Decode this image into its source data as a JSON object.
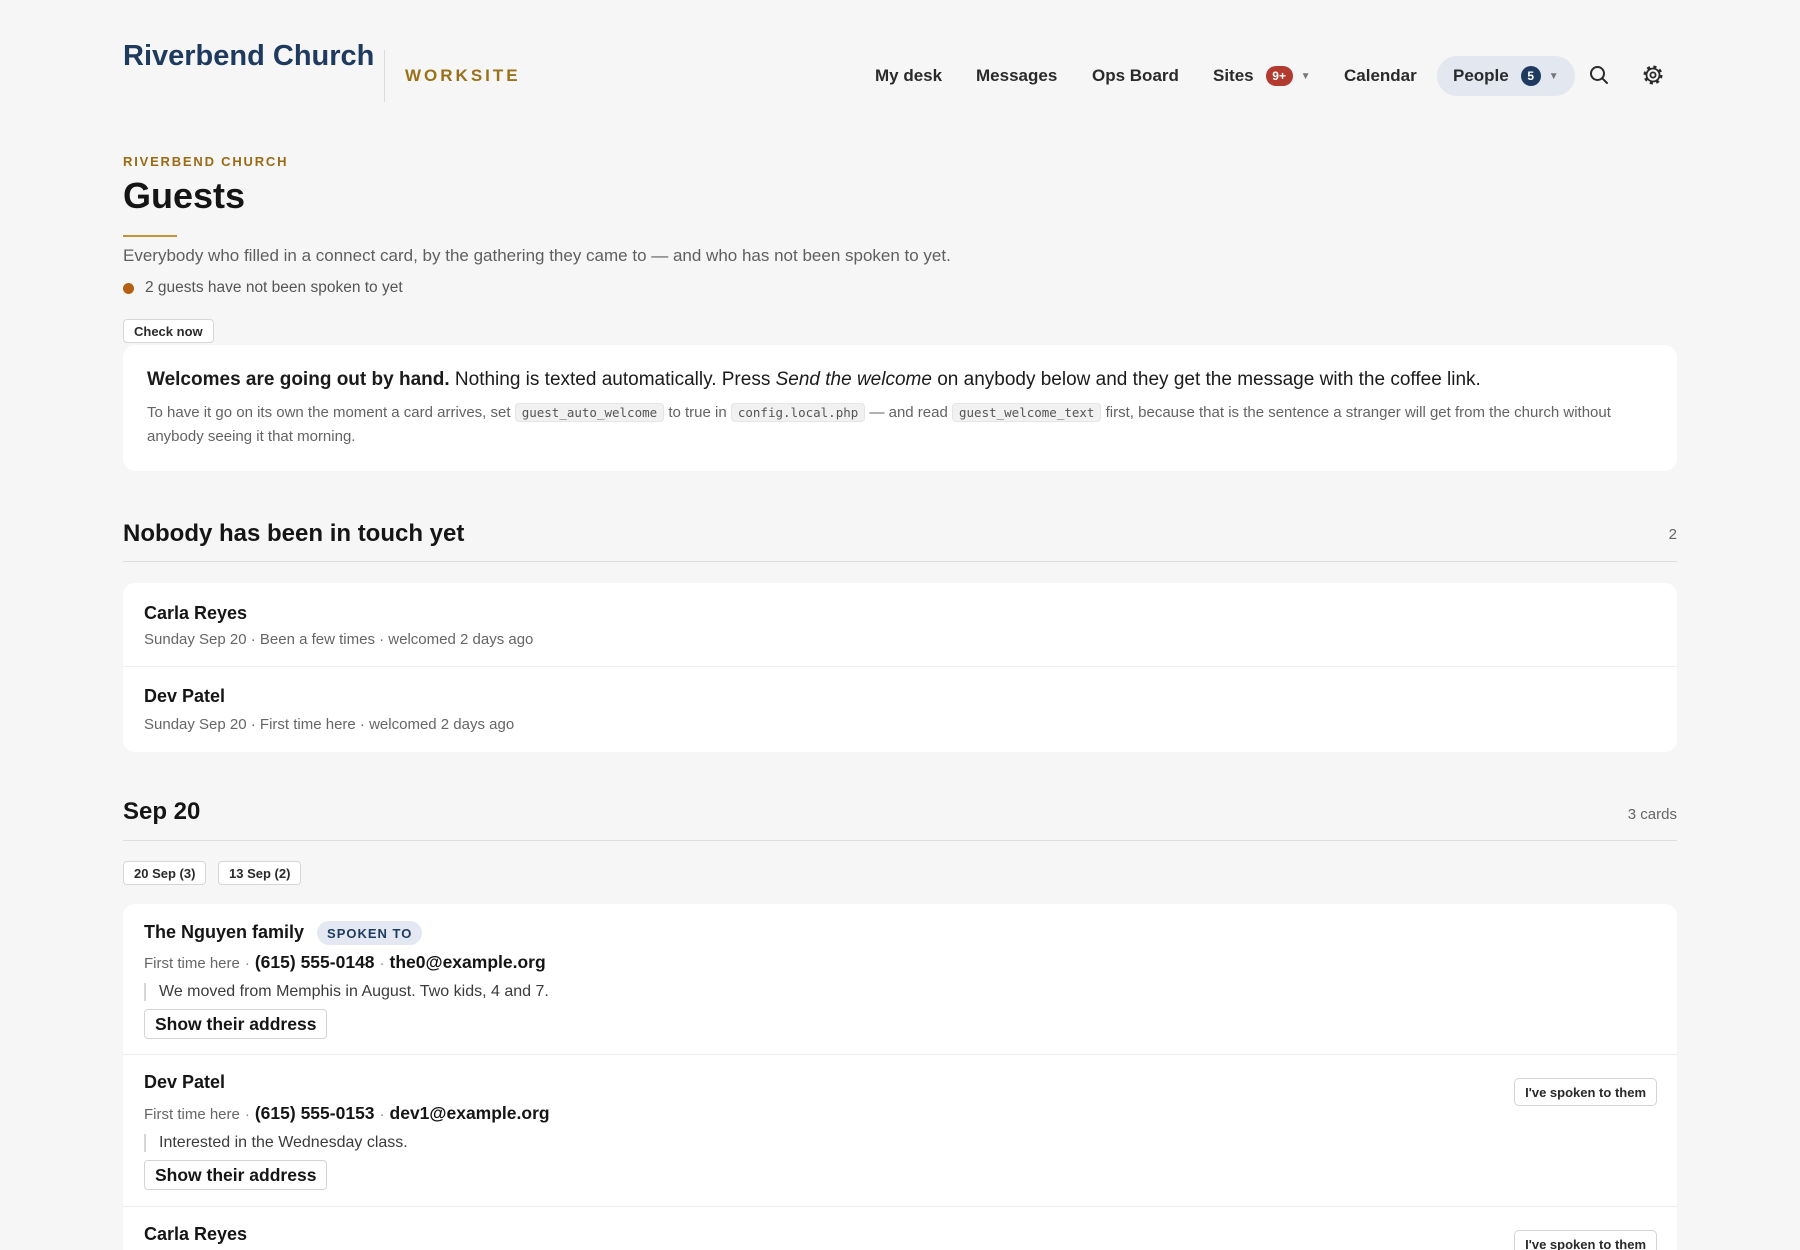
{
  "header": {
    "brand": "Riverbend Church",
    "area": "WORKSITE",
    "nav": [
      {
        "label": "My desk"
      },
      {
        "label": "Messages"
      },
      {
        "label": "Ops Board"
      },
      {
        "label": "Sites",
        "badge": "9+",
        "badge_color": "#b23a2e"
      },
      {
        "label": "Calendar"
      },
      {
        "label": "People",
        "badge": "5",
        "badge_color": "#1f3a5f",
        "active": true
      }
    ],
    "icons": [
      "search-icon",
      "gear-icon"
    ]
  },
  "page": {
    "eyebrow": "RIVERBEND CHURCH",
    "title": "Guests",
    "subtitle": "Everybody who filled in a connect card, by the gathering they came to — and who has not been spoken to yet.",
    "status": "2 guests have not been spoken to yet",
    "check_now": "Check now"
  },
  "notice": {
    "headline_bold": "Welcomes are going out by hand.",
    "headline_pre": " Nothing is texted automatically. Press ",
    "headline_em": "Send the welcome",
    "headline_post": " on anybody below and they get the message with the coffee link.",
    "body_1": "To have it go on its own the moment a card arrives, set ",
    "code_1": "guest_auto_welcome",
    "body_2": " to true in ",
    "code_2": "config.local.php",
    "body_3": " — and read ",
    "code_3": "guest_welcome_text",
    "body_4": " first, because that is the sentence a stranger will get from the church without anybody seeing it that morning."
  },
  "untouched": {
    "title": "Nobody has been in touch yet",
    "count": "2",
    "rows": [
      {
        "name": "Carla Reyes",
        "meta": "Sunday Sep 20 · Been a few times · welcomed 2 days ago"
      },
      {
        "name": "Dev Patel",
        "meta": "Sunday Sep 20 · First time here · welcomed 2 days ago"
      }
    ]
  },
  "gathering": {
    "title": "Sep 20",
    "count": "3 cards",
    "filters": [
      {
        "label": "20 Sep (3)"
      },
      {
        "label": "13 Sep (2)"
      }
    ],
    "cards": [
      {
        "name": "The Nguyen family",
        "badge": "SPOKEN TO",
        "visit": "First time here",
        "sep": "·",
        "phone": "(615) 555-0148",
        "email": "the0@example.org",
        "note": "We moved from Memphis in August. Two kids, 4 and 7.",
        "address_btn": "Show their address"
      },
      {
        "name": "Dev Patel",
        "visit": "First time here",
        "sep": "·",
        "phone": "(615) 555-0153",
        "email": "dev1@example.org",
        "note": "Interested in the Wednesday class.",
        "address_btn": "Show their address",
        "action": "I've spoken to them"
      },
      {
        "name": "Carla Reyes",
        "action": "I've spoken to them"
      }
    ]
  }
}
